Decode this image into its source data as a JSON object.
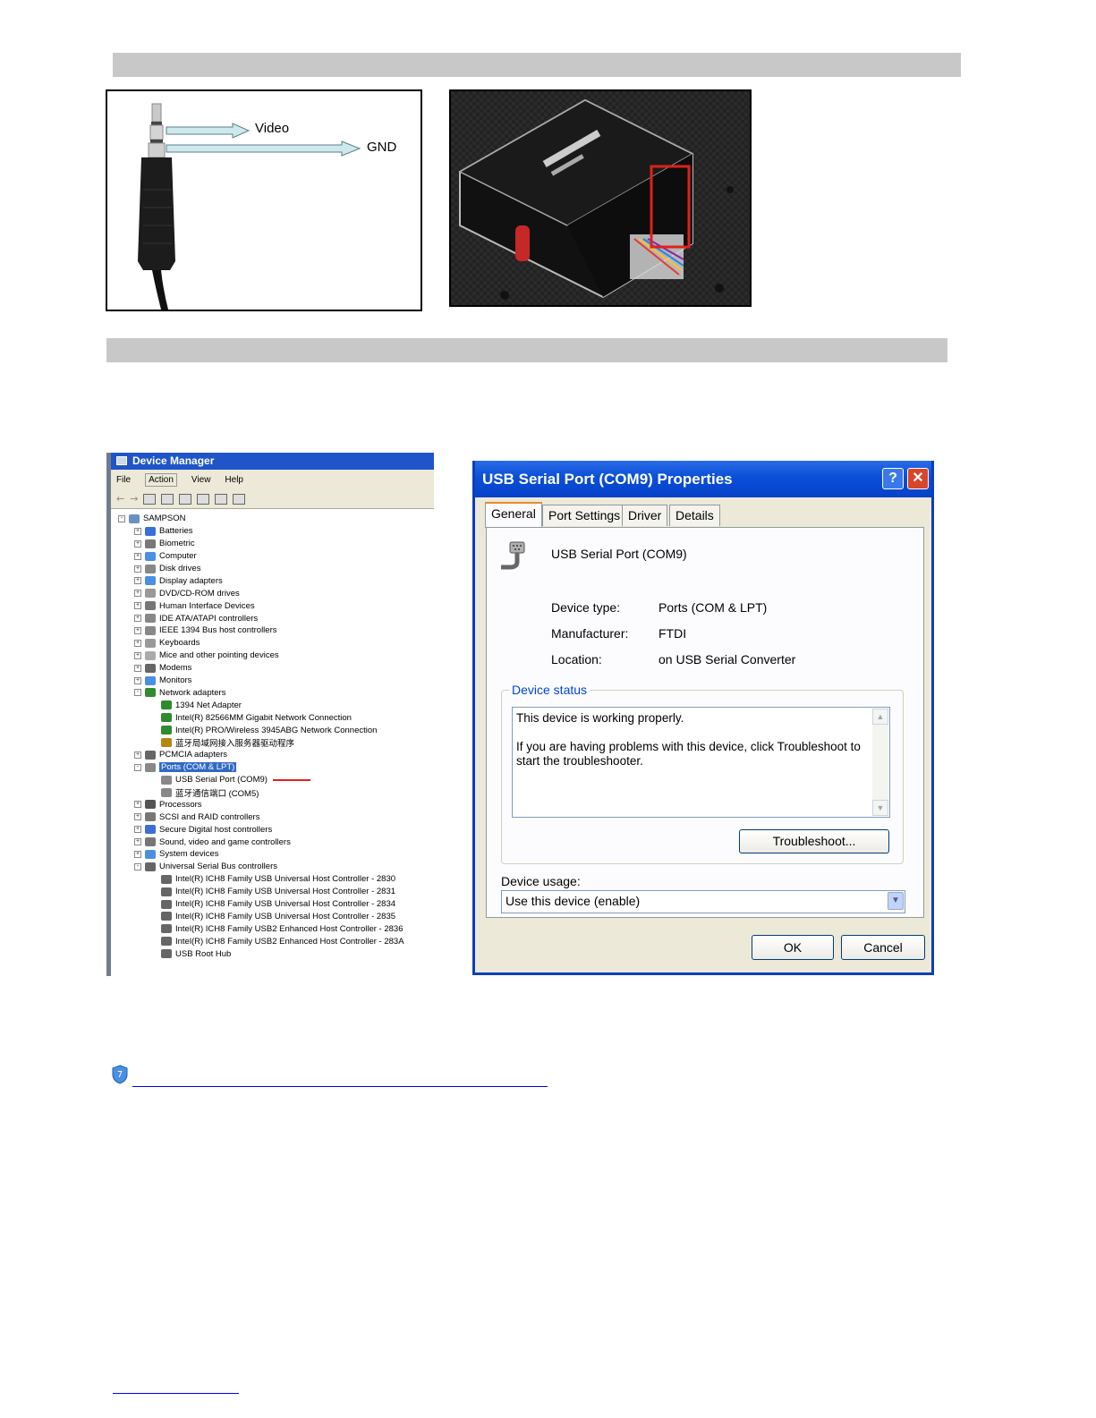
{
  "jack_diagram": {
    "video_label": "Video",
    "gnd_label": "GND"
  },
  "device_manager": {
    "title": "Device Manager",
    "menu": [
      "File",
      "Action",
      "View",
      "Help"
    ],
    "root": "SAMPSON",
    "items": [
      {
        "label": "Batteries",
        "level": 1,
        "state": "+",
        "color": "#3a6fd8"
      },
      {
        "label": "Biometric",
        "level": 1,
        "state": "+",
        "color": "#777777"
      },
      {
        "label": "Computer",
        "level": 1,
        "state": "+",
        "color": "#4a90e2"
      },
      {
        "label": "Disk drives",
        "level": 1,
        "state": "+",
        "color": "#888888"
      },
      {
        "label": "Display adapters",
        "level": 1,
        "state": "+",
        "color": "#4a90e2"
      },
      {
        "label": "DVD/CD-ROM drives",
        "level": 1,
        "state": "+",
        "color": "#999999"
      },
      {
        "label": "Human Interface Devices",
        "level": 1,
        "state": "+",
        "color": "#777777"
      },
      {
        "label": "IDE ATA/ATAPI controllers",
        "level": 1,
        "state": "+",
        "color": "#888888"
      },
      {
        "label": "IEEE 1394 Bus host controllers",
        "level": 1,
        "state": "+",
        "color": "#888888"
      },
      {
        "label": "Keyboards",
        "level": 1,
        "state": "+",
        "color": "#999999"
      },
      {
        "label": "Mice and other pointing devices",
        "level": 1,
        "state": "+",
        "color": "#aaaaaa"
      },
      {
        "label": "Modems",
        "level": 1,
        "state": "+",
        "color": "#666666"
      },
      {
        "label": "Monitors",
        "level": 1,
        "state": "+",
        "color": "#4a90e2"
      },
      {
        "label": "Network adapters",
        "level": 1,
        "state": "-",
        "color": "#2e8b2e"
      },
      {
        "label": "1394 Net Adapter",
        "level": 2,
        "state": "",
        "color": "#2e8b2e"
      },
      {
        "label": "Intel(R) 82566MM Gigabit Network Connection",
        "level": 2,
        "state": "",
        "color": "#2e8b2e"
      },
      {
        "label": "Intel(R) PRO/Wireless 3945ABG Network Connection",
        "level": 2,
        "state": "",
        "color": "#2e8b2e"
      },
      {
        "label": "蓝牙局域网接入服务器驱动程序",
        "level": 2,
        "state": "",
        "color": "#b8860b"
      },
      {
        "label": "PCMCIA adapters",
        "level": 1,
        "state": "+",
        "color": "#666666"
      },
      {
        "label": "Ports (COM & LPT)",
        "level": 1,
        "state": "-",
        "color": "#888888",
        "selected": true
      },
      {
        "label": "USB Serial Port (COM9)",
        "level": 2,
        "state": "",
        "color": "#888888",
        "marked": true
      },
      {
        "label": "蓝牙通信端口 (COM5)",
        "level": 2,
        "state": "",
        "color": "#888888"
      },
      {
        "label": "Processors",
        "level": 1,
        "state": "+",
        "color": "#555555"
      },
      {
        "label": "SCSI and RAID controllers",
        "level": 1,
        "state": "+",
        "color": "#777777"
      },
      {
        "label": "Secure Digital host controllers",
        "level": 1,
        "state": "+",
        "color": "#3a6fd8"
      },
      {
        "label": "Sound, video and game controllers",
        "level": 1,
        "state": "+",
        "color": "#777777"
      },
      {
        "label": "System devices",
        "level": 1,
        "state": "+",
        "color": "#4a90e2"
      },
      {
        "label": "Universal Serial Bus controllers",
        "level": 1,
        "state": "-",
        "color": "#666666"
      },
      {
        "label": "Intel(R) ICH8 Family USB Universal Host Controller - 2830",
        "level": 2,
        "state": "",
        "color": "#666666"
      },
      {
        "label": "Intel(R) ICH8 Family USB Universal Host Controller - 2831",
        "level": 2,
        "state": "",
        "color": "#666666"
      },
      {
        "label": "Intel(R) ICH8 Family USB Universal Host Controller - 2834",
        "level": 2,
        "state": "",
        "color": "#666666"
      },
      {
        "label": "Intel(R) ICH8 Family USB Universal Host Controller - 2835",
        "level": 2,
        "state": "",
        "color": "#666666"
      },
      {
        "label": "Intel(R) ICH8 Family USB2 Enhanced Host Controller - 2836",
        "level": 2,
        "state": "",
        "color": "#666666"
      },
      {
        "label": "Intel(R) ICH8 Family USB2 Enhanced Host Controller - 283A",
        "level": 2,
        "state": "",
        "color": "#666666"
      },
      {
        "label": "USB Root Hub",
        "level": 2,
        "state": "",
        "color": "#666666"
      }
    ]
  },
  "properties": {
    "title": "USB Serial Port (COM9) Properties",
    "help_btn": "?",
    "close_btn": "✕",
    "tabs": [
      "General",
      "Port Settings",
      "Driver",
      "Details"
    ],
    "device_name": "USB Serial Port (COM9)",
    "device_type_label": "Device type:",
    "device_type_value": "Ports (COM & LPT)",
    "manufacturer_label": "Manufacturer:",
    "manufacturer_value": "FTDI",
    "location_label": "Location:",
    "location_value": "on USB Serial Converter",
    "status_group": "Device status",
    "status_line1": "This device is working properly.",
    "status_line2": "If you are having problems with this device, click Troubleshoot to start the troubleshooter.",
    "troubleshoot_btn": "Troubleshoot...",
    "usage_label": "Device usage:",
    "usage_value": "Use this device (enable)",
    "ok_btn": "OK",
    "cancel_btn": "Cancel"
  },
  "colors": {
    "section_bar": "#c8c8c8",
    "xp_blue": "#0a4fd8",
    "link": "#0000ee"
  }
}
